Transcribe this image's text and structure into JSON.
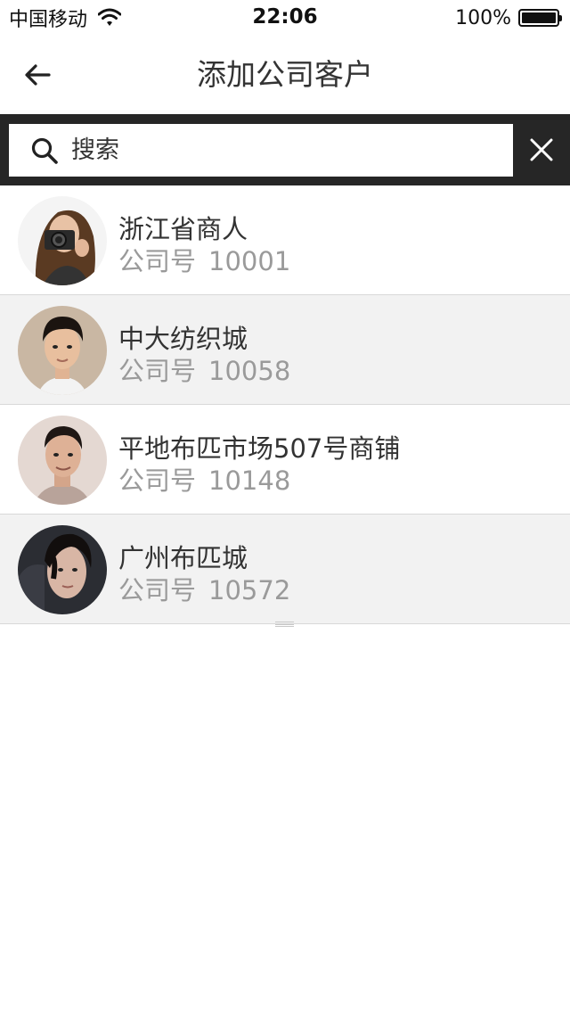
{
  "status_bar": {
    "carrier": "中国移动",
    "time": "22:06",
    "battery": "100%"
  },
  "nav": {
    "title": "添加公司客户"
  },
  "search": {
    "placeholder": "搜索",
    "value": ""
  },
  "customers": [
    {
      "name": "浙江省商人",
      "label": "公司号",
      "number": "10001"
    },
    {
      "name": "中大纺织城",
      "label": "公司号",
      "number": "10058"
    },
    {
      "name": "平地布匹市场507号商铺",
      "label": "公司号",
      "number": "10148"
    },
    {
      "name": "广州布匹城",
      "label": "公司号",
      "number": "10572"
    }
  ],
  "icons": {
    "back": "arrow-left-icon",
    "search": "search-icon",
    "close": "close-icon",
    "wifi": "wifi-icon",
    "battery": "battery-icon"
  },
  "colors": {
    "search_bar_bg": "#262626",
    "alt_row_bg": "#f2f2f2",
    "secondary_text": "#9a9a9a"
  }
}
